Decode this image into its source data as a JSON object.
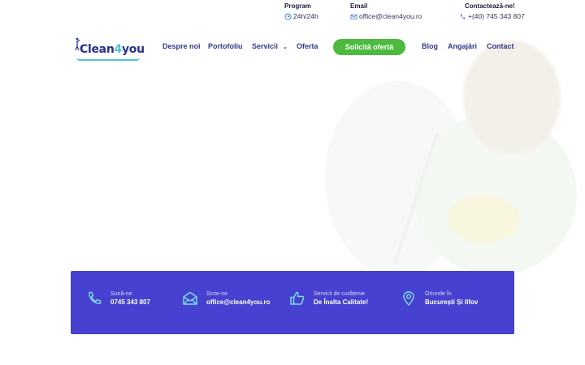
{
  "topbar": {
    "program": {
      "label": "Program",
      "value": "24h/24h"
    },
    "email": {
      "label": "Email",
      "value": "office@clean4you.ro"
    },
    "contact": {
      "label": "Contactează-ne!",
      "value": "+(40) 745 343 807"
    }
  },
  "logo": {
    "part1": "Clean",
    "part2": "4",
    "part3": "you"
  },
  "nav": {
    "items": [
      "Despre noi",
      "Portofoliu",
      "Servicii",
      "Oferta",
      "Blog",
      "Angajări",
      "Contact"
    ],
    "cta": "Solicită ofertă"
  },
  "band": {
    "items": [
      {
        "small": "Sună-ne",
        "big": "0745 343 807",
        "icon": "phone-icon"
      },
      {
        "small": "Scrie-ne",
        "big": "office@clean4you.ro",
        "icon": "envelope-icon"
      },
      {
        "small": "Servicii de curățenie",
        "big": "De Înalta Calitate!",
        "icon": "thumbs-up-icon"
      },
      {
        "small": "Oriunde în",
        "big": "București Și Ilfov",
        "icon": "map-pin-icon"
      }
    ]
  },
  "colors": {
    "brand": "#4641d0",
    "cta": "#4cba3f",
    "accent": "#4fc3d8",
    "nav": "#35398a"
  }
}
